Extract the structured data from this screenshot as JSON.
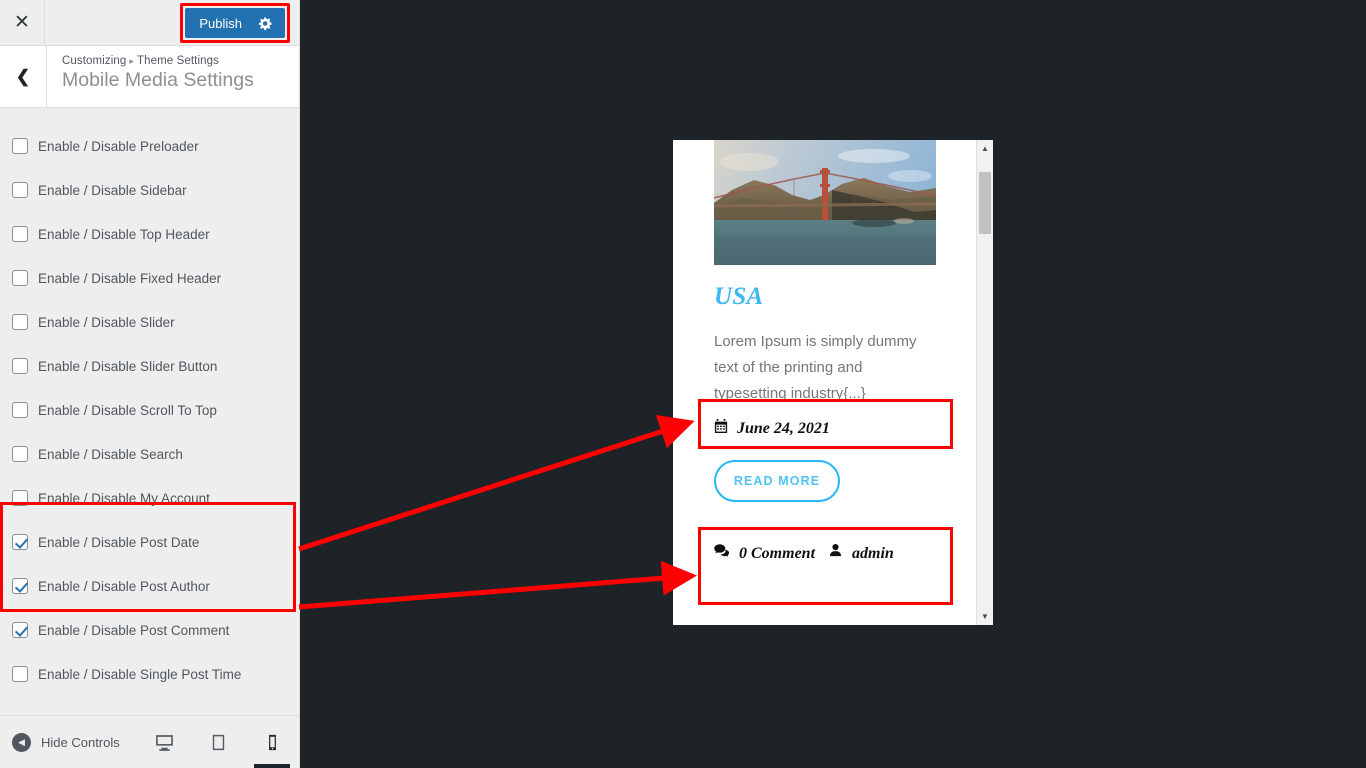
{
  "window": {
    "close_icon": "close-icon",
    "publish_label": "Publish",
    "publish_gear_icon": "gear-icon",
    "accent_blue": "#2271b1",
    "highlight_red": "#ff0000",
    "backdrop_color": "#1e2327",
    "sidebar_color": "#eeeeee"
  },
  "header": {
    "back_icon": "chevron-left-icon",
    "breadcrumb_root": "Customizing",
    "breadcrumb_separator": "▸",
    "breadcrumb_parent": "Theme Settings",
    "panel_title": "Mobile Media Settings"
  },
  "controls": [
    {
      "label": "Enable / Disable Preloader",
      "checked": false
    },
    {
      "label": "Enable / Disable Sidebar",
      "checked": false
    },
    {
      "label": "Enable / Disable Top Header",
      "checked": false
    },
    {
      "label": "Enable / Disable Fixed Header",
      "checked": false
    },
    {
      "label": "Enable / Disable Slider",
      "checked": false
    },
    {
      "label": "Enable / Disable Slider Button",
      "checked": false
    },
    {
      "label": "Enable / Disable Scroll To Top",
      "checked": false
    },
    {
      "label": "Enable / Disable Search",
      "checked": false
    },
    {
      "label": "Enable / Disable My Account",
      "checked": false
    },
    {
      "label": "Enable / Disable Post Date",
      "checked": true
    },
    {
      "label": "Enable / Disable Post Author",
      "checked": true
    },
    {
      "label": "Enable / Disable Post Comment",
      "checked": true
    },
    {
      "label": "Enable / Disable Single Post Time",
      "checked": false
    }
  ],
  "footer": {
    "collapse_icon": "collapse-left-icon",
    "hide_controls_label": "Hide Controls",
    "devices": [
      {
        "name": "desktop",
        "icon": "desktop-icon",
        "active": false
      },
      {
        "name": "tablet",
        "icon": "tablet-icon",
        "active": false
      },
      {
        "name": "mobile",
        "icon": "mobile-icon",
        "active": true
      }
    ]
  },
  "preview": {
    "post": {
      "thumbnail_icon": "golden-gate-bridge-photo",
      "title": "USA",
      "title_color": "#3cb9f0",
      "excerpt": "Lorem Ipsum is simply dummy text of the printing and typesetting industry{...}",
      "date_icon": "calendar-icon",
      "date": "June 24, 2021",
      "read_more_label": "READ MORE",
      "read_more_color": "#29b6f6",
      "comment_icon": "comment-icon",
      "comment_text": "0 Comment",
      "author_icon": "user-icon",
      "author": "admin"
    },
    "scrollbar": {
      "up_arrow_icon": "caret-up-icon",
      "down_arrow_icon": "caret-down-icon"
    }
  }
}
